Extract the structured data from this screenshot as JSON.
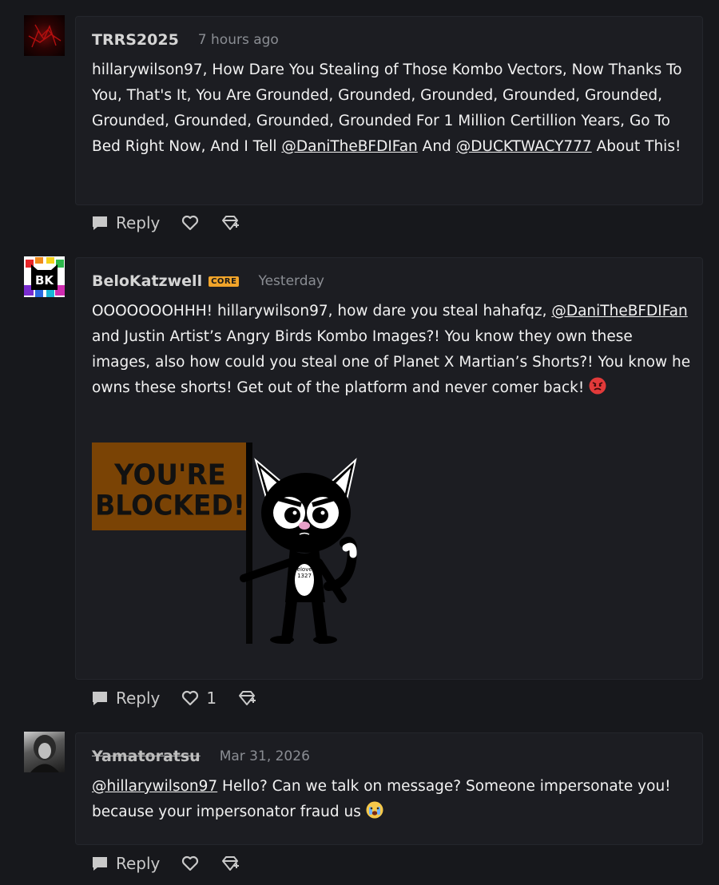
{
  "comments": [
    {
      "author": "TRRS2025",
      "time": "7 hours ago",
      "text_parts": [
        "hillarywilson97, How Dare You Stealing of Those Kombo Vectors, Now Thanks To You, That's It, You Are Grounded, Grounded, Grounded, Grounded, Grounded, Grounded, Grounded, Grounded, Grounded For 1 Million Certillion Years, Go To Bed Right Now, And I Tell ",
        "@DaniTheBFDIFan",
        " And ",
        "@DUCKTWACY777",
        " About This!"
      ],
      "reply_label": "Reply"
    },
    {
      "author": "BeloKatzwell",
      "badge": "CORE",
      "time": "Yesterday",
      "text_parts": [
        "OOOOOOOHHH! hillarywilson97, how dare you steal hahafqz, ",
        "@DaniTheBFDIFan",
        " and Justin Artist’s Angry Birds Kombo Images?! You know they own these images, also how could you steal one of Planet X Martian’s Shorts?! You know he owns these shorts! Get out of the platform and never comer back! "
      ],
      "image": {
        "sign_line1": "YOU'RE",
        "sign_line2": "BLOCKED!",
        "shirt_line1": "Beloved",
        "shirt_line2": "1327"
      },
      "avatar_text": "BK",
      "reply_label": "Reply",
      "like_count": "1"
    },
    {
      "author": "Yamatoratsu",
      "time": "Mar 31, 2026",
      "text_parts": [
        "@hillarywilson97",
        " Hello? Can we talk on message? Someone impersonate you!  because your impersonator fraud us "
      ],
      "reply_label": "Reply"
    }
  ],
  "icons": {
    "reply": "speech-bubble-icon",
    "like": "heart-icon",
    "award": "award-icon",
    "angry": "angry-face-emoji",
    "crying": "crying-face-emoji"
  },
  "colors": {
    "background": "#17181c",
    "card": "#1c1d22",
    "badge": "#f1a42a",
    "sign": "#7a4305"
  }
}
